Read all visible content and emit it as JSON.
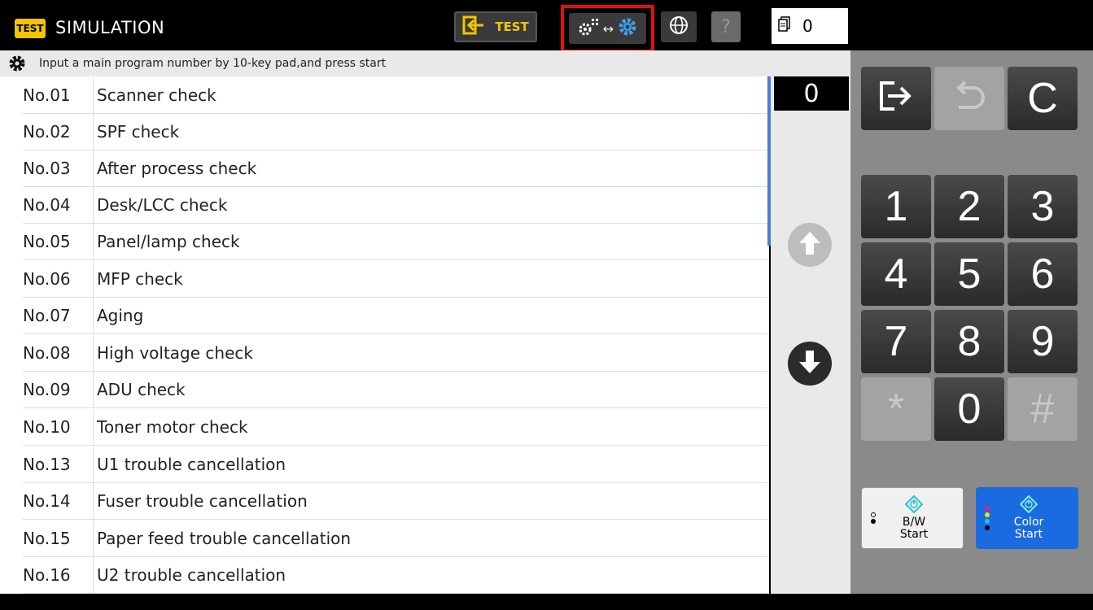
{
  "header": {
    "badge": "TEST",
    "title": "SIMULATION",
    "test_button_label": "TEST",
    "help_label": "?",
    "counter_value": "0"
  },
  "info": {
    "message": "Input a main program number by 10-key pad,and press start"
  },
  "programs": [
    {
      "no": "No.01",
      "name": "Scanner check"
    },
    {
      "no": "No.02",
      "name": "SPF check"
    },
    {
      "no": "No.03",
      "name": "After process check"
    },
    {
      "no": "No.04",
      "name": "Desk/LCC check"
    },
    {
      "no": "No.05",
      "name": "Panel/lamp check"
    },
    {
      "no": "No.06",
      "name": "MFP check"
    },
    {
      "no": "No.07",
      "name": "Aging"
    },
    {
      "no": "No.08",
      "name": "High voltage check"
    },
    {
      "no": "No.09",
      "name": "ADU check"
    },
    {
      "no": "No.10",
      "name": "Toner motor check"
    },
    {
      "no": "No.13",
      "name": "U1 trouble cancellation"
    },
    {
      "no": "No.14",
      "name": "Fuser trouble cancellation"
    },
    {
      "no": "No.15",
      "name": "Paper feed trouble cancellation"
    },
    {
      "no": "No.16",
      "name": "U2 trouble cancellation"
    }
  ],
  "input_display": "0",
  "keypad": {
    "clear": "C",
    "keys": [
      "1",
      "2",
      "3",
      "4",
      "5",
      "6",
      "7",
      "8",
      "9",
      "*",
      "0",
      "#"
    ]
  },
  "start": {
    "bw_line1": "B/W",
    "bw_line2": "Start",
    "color_line1": "Color",
    "color_line2": "Start"
  },
  "colors": {
    "badge_yellow": "#f5c400",
    "highlight_red": "#e31010",
    "scrollbar_blue": "#4a7bd3",
    "color_start_blue": "#1a6be0"
  },
  "icons": {
    "top_swap": "gears-swap-icon",
    "globe": "globe-icon",
    "counter": "document-counter-icon",
    "exit": "exit-icon",
    "undo": "undo-icon"
  }
}
